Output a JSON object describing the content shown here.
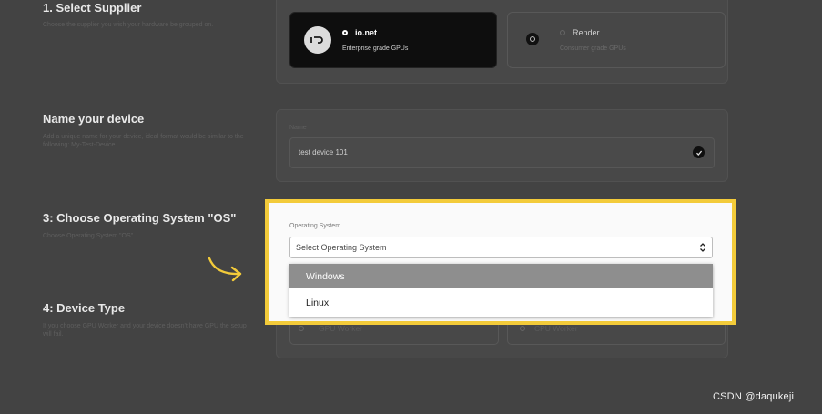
{
  "step1": {
    "title": "1. Select Supplier",
    "description": "Choose the supplier you wish your hardware be grouped on.",
    "options": [
      {
        "name": "io.net",
        "sub": "Enterprise grade GPUs",
        "selected": true
      },
      {
        "name": "Render",
        "sub": "Consumer grade GPUs",
        "selected": false
      }
    ]
  },
  "step2": {
    "title": "Name your device",
    "description": "Add a unique name for your device, ideal format would be similar to the following: My-Test-Device",
    "field_label": "Name",
    "field_value": "test device 101"
  },
  "step3": {
    "title": "3: Choose Operating System \"OS\"",
    "description": "Choose Operating System \"OS\".",
    "field_label": "Operating System",
    "placeholder": "Select Operating System",
    "options": [
      "Windows",
      "Linux"
    ],
    "highlighted_option": "Windows"
  },
  "step4": {
    "title": "4: Device Type",
    "description": "If you choose GPU Worker and your device doesn't have GPU the setup will fail.",
    "options": [
      "GPU Worker",
      "CPU Worker"
    ]
  },
  "watermark": "CSDN @daqukeji",
  "colors": {
    "highlight_border": "#f3cb3a",
    "arrow": "#f3cb3a",
    "background": "#434343"
  }
}
